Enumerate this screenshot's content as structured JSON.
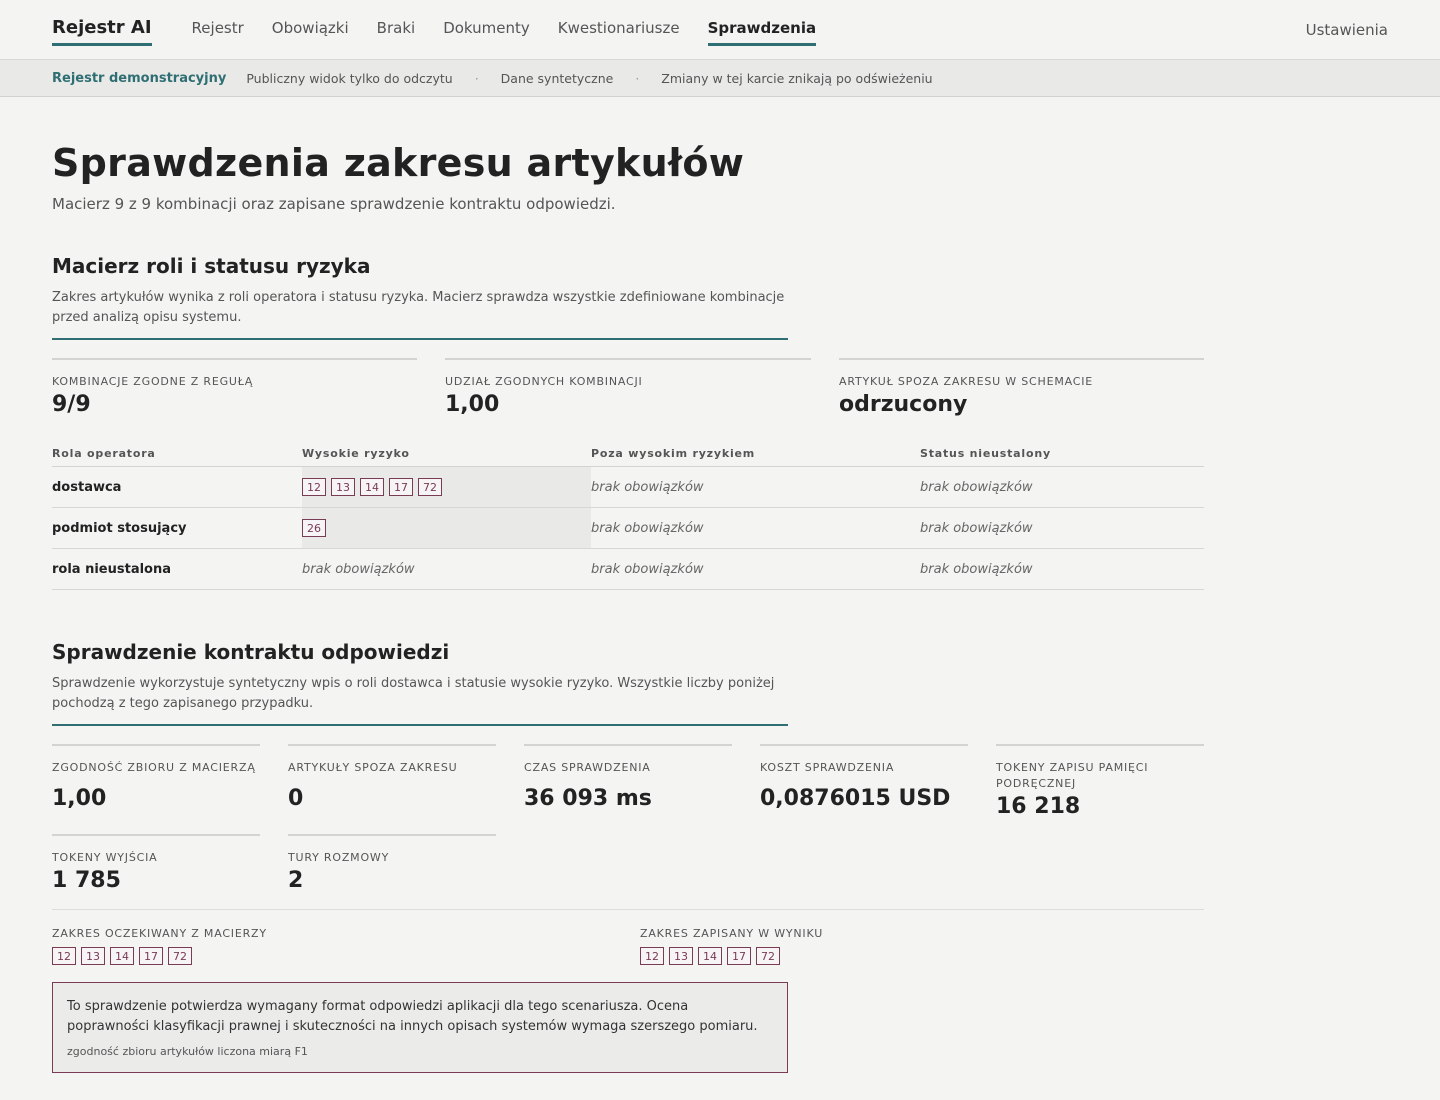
{
  "nav": {
    "brand": "Rejestr AI",
    "links": [
      "Rejestr",
      "Obowiązki",
      "Braki",
      "Dokumenty",
      "Kwestionariusze",
      "Sprawdzenia"
    ],
    "settings": "Ustawienia"
  },
  "banner": {
    "title": "Rejestr demonstracyjny",
    "items": [
      "Publiczny widok tylko do odczytu",
      "Dane syntetyczne",
      "Zmiany w tej karcie znikają po odświeżeniu"
    ]
  },
  "page": {
    "title": "Sprawdzenia zakresu artykułów",
    "subtitle": "Macierz 9 z 9 kombinacji oraz zapisane sprawdzenie kontraktu odpowiedzi."
  },
  "matrix_section": {
    "title": "Macierz roli i statusu ryzyka",
    "description": "Zakres artykułów wynika z roli operatora i statusu ryzyka. Macierz sprawdza wszystkie zdefiniowane kombinacje przed analizą opisu systemu.",
    "stats": [
      {
        "label": "Kombinacje zgodne z regułą",
        "value": "9/9"
      },
      {
        "label": "Udział zgodnych kombinacji",
        "value": "1,00"
      },
      {
        "label": "Artykuł spoza zakresu w schemacie",
        "value": "odrzucony"
      }
    ],
    "table": {
      "headers": [
        "Rola operatora",
        "Wysokie ryzyko",
        "Poza wysokim ryzykiem",
        "Status nieustalony"
      ],
      "empty_text": "brak obowiązków",
      "rows": [
        {
          "role": "dostawca",
          "high": [
            "12",
            "13",
            "14",
            "17",
            "72"
          ]
        },
        {
          "role": "podmiot stosujący",
          "high": [
            "26"
          ]
        },
        {
          "role": "rola nieustalona",
          "high": []
        }
      ]
    }
  },
  "contract_section": {
    "title": "Sprawdzenie kontraktu odpowiedzi",
    "description": "Sprawdzenie wykorzystuje syntetyczny wpis o roli dostawca i statusie wysokie ryzyko. Wszystkie liczby poniżej pochodzą z tego zapisanego przypadku.",
    "stats": [
      {
        "label": "Zgodność zbioru z macierzą",
        "value": "1,00"
      },
      {
        "label": "Artykuły spoza zakresu",
        "value": "0"
      },
      {
        "label": "Czas sprawdzenia",
        "value": "36 093 ms"
      },
      {
        "label": "Koszt sprawdzenia",
        "value": "0,0876015 USD"
      },
      {
        "label": "Tokeny zapisu pamięci podręcznej",
        "value": "16 218"
      },
      {
        "label": "Tokeny wyjścia",
        "value": "1 785"
      },
      {
        "label": "Tury rozmowy",
        "value": "2"
      }
    ],
    "expected_label": "Zakres oczekiwany z macierzy",
    "expected": [
      "12",
      "13",
      "14",
      "17",
      "72"
    ],
    "saved_label": "Zakres zapisany w wyniku",
    "saved": [
      "12",
      "13",
      "14",
      "17",
      "72"
    ],
    "note": "To sprawdzenie potwierdza wymagany format odpowiedzi aplikacji dla tego scenariusza. Ocena poprawności klasyfikacji prawnej i skuteczności na innych opisach systemów wymaga szerszego pomiaru.",
    "note_foot": "zgodność zbioru artykułów liczona miarą F1"
  }
}
